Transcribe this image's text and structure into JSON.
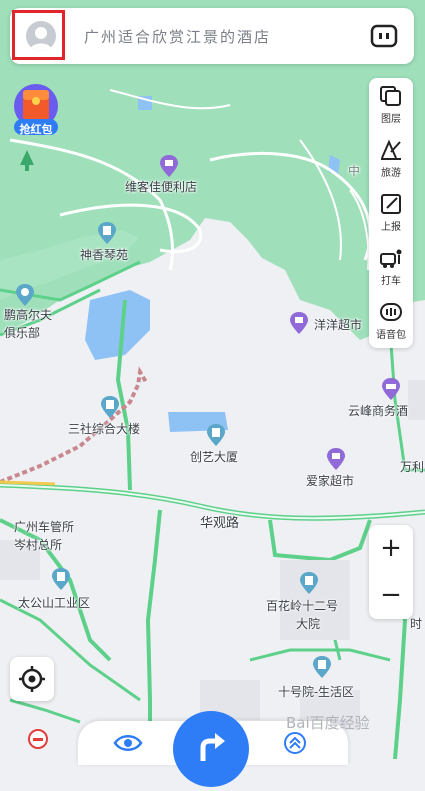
{
  "search": {
    "placeholder": "广州适合欣赏江景的酒店"
  },
  "red_packet": {
    "label": "抢红包"
  },
  "side_tools": [
    {
      "label": "图层",
      "icon": "layers-icon"
    },
    {
      "label": "旅游",
      "icon": "travel-icon"
    },
    {
      "label": "上报",
      "icon": "report-icon"
    },
    {
      "label": "打车",
      "icon": "taxi-icon"
    },
    {
      "label": "语音包",
      "icon": "voice-pack-icon"
    }
  ],
  "zoom": {
    "in_label": "+",
    "out_label": "−"
  },
  "map": {
    "labels": [
      {
        "id": "weike",
        "text": "维客佳便利店",
        "icon": "store"
      },
      {
        "id": "shenxiang",
        "text": "神香琴苑",
        "icon": "building"
      },
      {
        "id": "penggaoerfu",
        "text": "鹏高尔夫",
        "icon": "pin"
      },
      {
        "id": "julebu",
        "text": "俱乐部",
        "icon": "none"
      },
      {
        "id": "yangyang",
        "text": "洋洋超市",
        "icon": "store"
      },
      {
        "id": "yunfeng",
        "text": "云峰商务酒",
        "icon": "hotel"
      },
      {
        "id": "sanshe",
        "text": "三社综合大楼",
        "icon": "building"
      },
      {
        "id": "chuangyi",
        "text": "创艺大厦",
        "icon": "building"
      },
      {
        "id": "aijia",
        "text": "爱家超市",
        "icon": "store"
      },
      {
        "id": "wanfang",
        "text": "万利",
        "icon": "none"
      },
      {
        "id": "huaguan",
        "text": "华观路",
        "icon": "none"
      },
      {
        "id": "chegong1",
        "text": "广州车管所",
        "icon": "none"
      },
      {
        "id": "chegong2",
        "text": "岑村总所",
        "icon": "none"
      },
      {
        "id": "taigongshan",
        "text": "太公山工业区",
        "icon": "building"
      },
      {
        "id": "baihua1",
        "text": "百花岭十二号",
        "icon": "building"
      },
      {
        "id": "baihua2",
        "text": "大院",
        "icon": "none"
      },
      {
        "id": "shihaoyuan",
        "text": "十号院-生活区",
        "icon": "building"
      },
      {
        "id": "zhong",
        "text": "中",
        "icon": "none"
      },
      {
        "id": "edge",
        "text": "时",
        "icon": "none"
      }
    ]
  },
  "watermark": {
    "text": "Bai百度经验"
  },
  "colors": {
    "green_area": "#9fe0bb",
    "water": "#8fc2f4",
    "road": "#5dd08a",
    "accent": "#2f7df6",
    "poi_building": "#5aa7c9",
    "poi_store": "#8f6ad8"
  }
}
